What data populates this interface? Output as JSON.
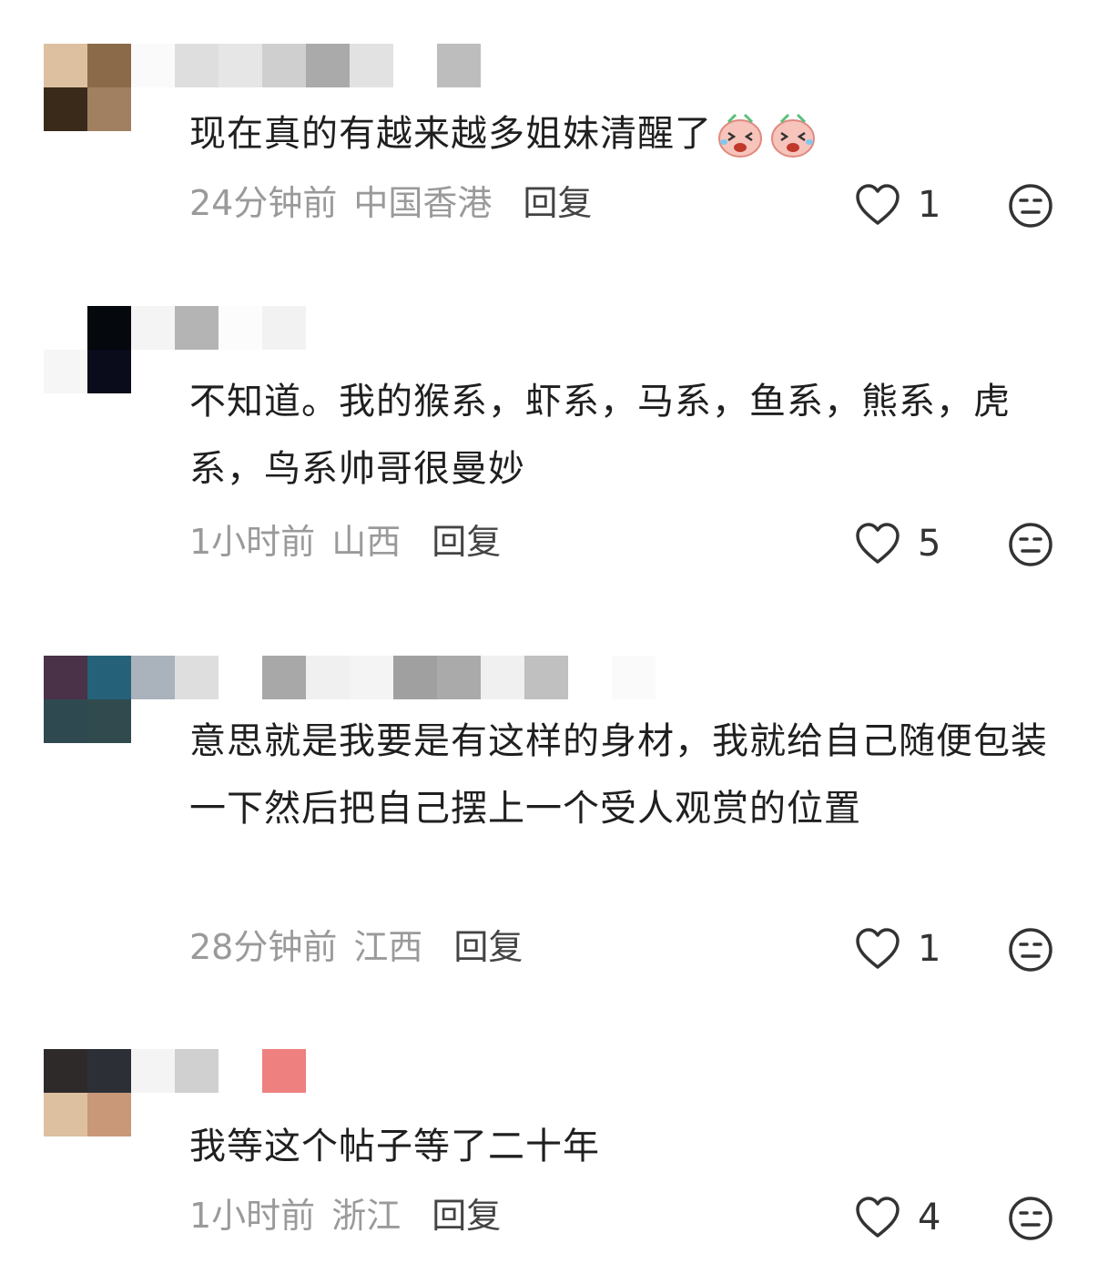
{
  "comments": [
    {
      "text": "现在真的有越来越多姐妹清醒了",
      "time": "24分钟前",
      "location": "中国香港",
      "reply_label": "回复",
      "likes": "1",
      "emojis": [
        "crying-laughing-pig-emoji",
        "crying-laughing-pig-emoji"
      ]
    },
    {
      "text": "不知道。我的猴系，虾系，马系，鱼系，熊系，虎系，鸟系帅哥很曼妙",
      "time": "1小时前",
      "location": "山西",
      "reply_label": "回复",
      "likes": "5"
    },
    {
      "text": "意思就是我要是有这样的身材，我就给自己随便包装一下然后把自己摆上一个受人观赏的位置",
      "time": "28分钟前",
      "location": "江西",
      "reply_label": "回复",
      "likes": "1"
    },
    {
      "text": "我等这个帖子等了二十年",
      "time": "1小时前",
      "location": "浙江",
      "reply_label": "回复",
      "likes": "4"
    }
  ],
  "icons": {
    "like": "heart-outline-icon",
    "dislike": "neutral-face-icon"
  },
  "colors": {
    "text": "#1f1f1f",
    "meta": "#9a9a9a",
    "icon": "#333333"
  }
}
